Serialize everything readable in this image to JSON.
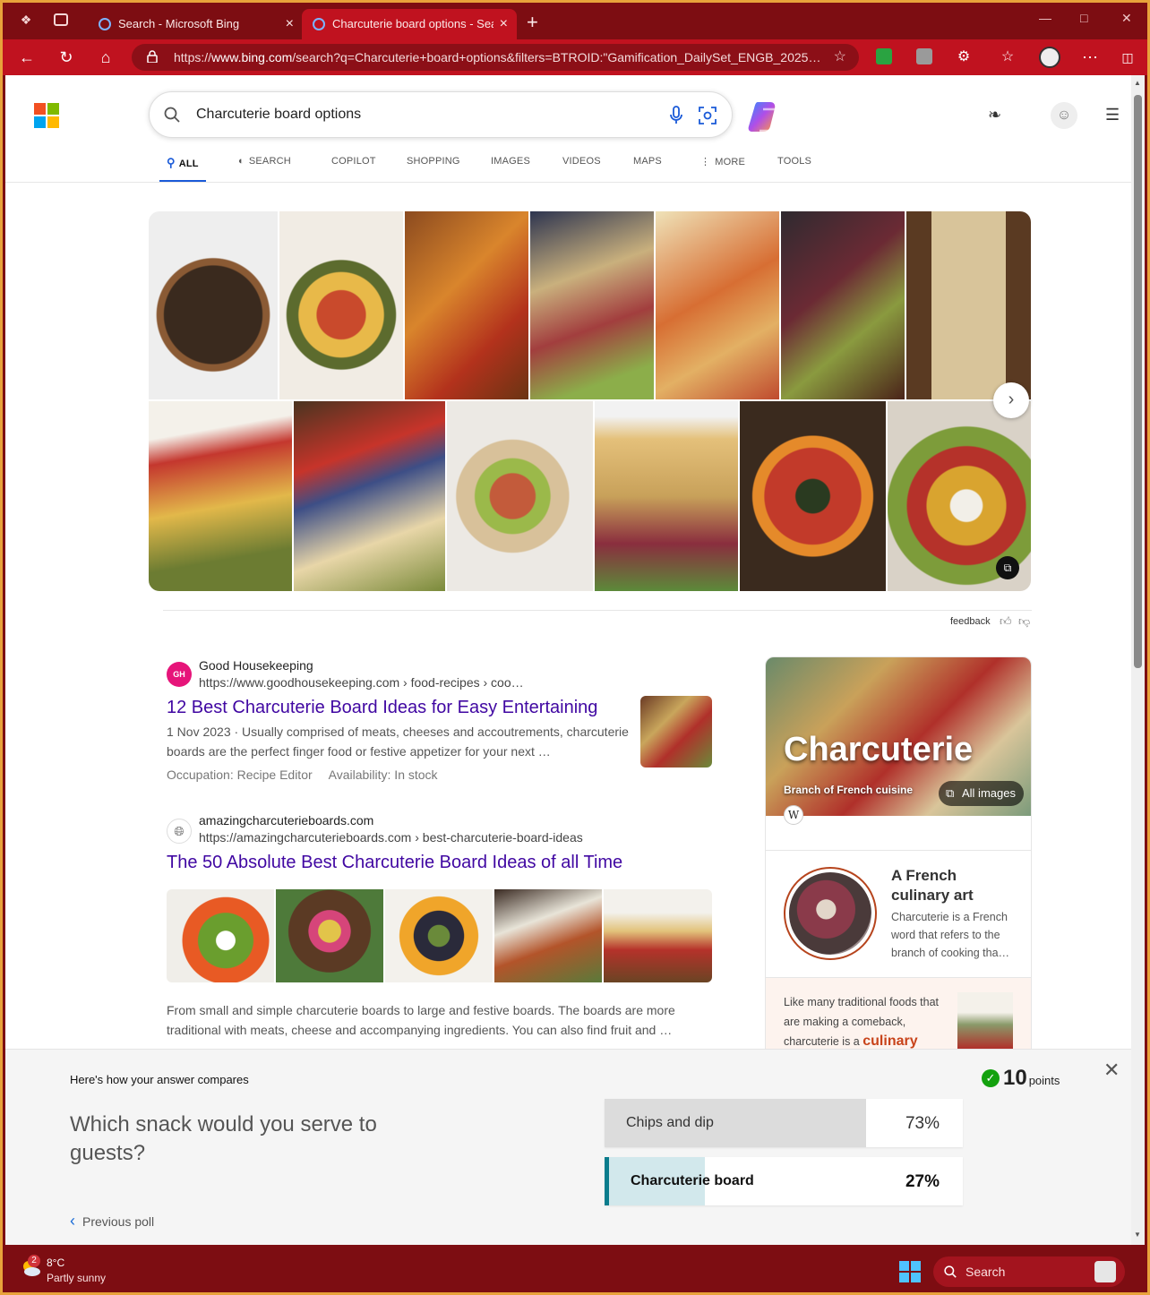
{
  "browser": {
    "tabs": [
      {
        "title": "Search - Microsoft Bing"
      },
      {
        "title": "Charcuterie board options - Search"
      }
    ],
    "url_prefix": "https://",
    "url_domain": "www.bing.com",
    "url_rest": "/search?q=Charcuterie+board+options&filters=BTROID:\"Gamification_DailySet_ENGB_2025…"
  },
  "search": {
    "query": "Charcuterie board options",
    "tabs": [
      "ALL",
      "SEARCH",
      "COPILOT",
      "SHOPPING",
      "IMAGES",
      "VIDEOS",
      "MAPS",
      "MORE",
      "TOOLS"
    ]
  },
  "feedback": {
    "label": "feedback"
  },
  "results": [
    {
      "favicon_text": "GH",
      "site": "Good Housekeeping",
      "url": "https://www.goodhousekeeping.com › food-recipes › coo…",
      "title": "12 Best Charcuterie Board Ideas for Easy Entertaining",
      "snippet_line1": "1 Nov 2023 · Usually comprised of meats, cheeses and accoutrements, charcuterie",
      "snippet_line2": "boards are the perfect finger food or festive appetizer for your next …",
      "fact1": "Occupation: Recipe Editor",
      "fact2": "Availability: In stock"
    },
    {
      "site": "amazingcharcuterieboards.com",
      "url": "https://amazingcharcuterieboards.com › best-charcuterie-board-ideas",
      "title": "The 50 Absolute Best Charcuterie Board Ideas of all Time",
      "snippet_line1": "From small and simple charcuterie boards to large and festive boards. The boards are more",
      "snippet_line2": "traditional with meats, cheese and accompanying ingredients. You can also find fruit and …"
    }
  ],
  "knowledge_panel": {
    "title": "Charcuterie",
    "subtitle": "Branch of French cuisine",
    "all_images": "All images",
    "wiki": "W",
    "section_heading": "A French culinary art",
    "section_text": "Charcuterie is a French word that refers to the branch of cooking tha…",
    "bottom_text": "Like many traditional foods that are making a comeback, charcuterie is a",
    "bottom_highlight": "culinary"
  },
  "poll": {
    "header": "Here's how your answer compares",
    "question": "Which snack would you serve to guests?",
    "points_value": "10",
    "points_label": "points",
    "previous": "Previous poll",
    "options": [
      {
        "label": "Chips and dip",
        "percent_text": "73%",
        "percent": 73,
        "selected": false
      },
      {
        "label": "Charcuterie board",
        "percent_text": "27%",
        "percent": 27,
        "selected": true
      }
    ]
  },
  "taskbar": {
    "badge": "2",
    "temperature": "8°C",
    "weather": "Partly sunny",
    "search": "Search"
  },
  "colors": {
    "titlebar": "#7d0d12",
    "navbar": "#c0121f",
    "link": "#4007a2",
    "accent": "#1a5ad8",
    "poll_selected": "#0a7c8c",
    "points_check": "#13a10e"
  },
  "icons": [
    "workspaces-icon",
    "tab-actions-icon",
    "back-icon",
    "refresh-icon",
    "home-icon",
    "lock-icon",
    "favorite-star-icon",
    "extension-icon",
    "favorites-icon",
    "profile-icon",
    "more-icon",
    "sidebar-icon",
    "search-icon",
    "microphone-icon",
    "visual-search-icon",
    "copilot-icon",
    "rewards-icon",
    "account-icon",
    "hamburger-icon",
    "chevron-right-icon",
    "thumbs-up-icon",
    "thumbs-down-icon",
    "checkmark-icon",
    "close-icon",
    "chevron-left-icon",
    "weather-icon",
    "windows-start-icon"
  ]
}
